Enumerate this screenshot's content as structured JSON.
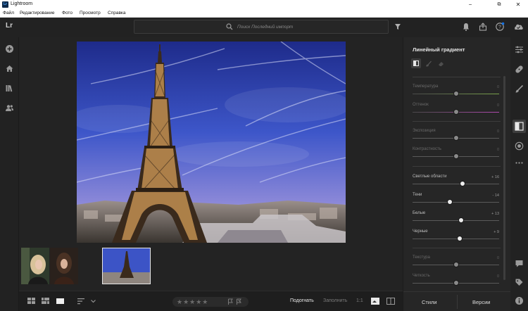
{
  "window": {
    "app_badge": "Lr",
    "title": "Lightroom",
    "minimize": "−",
    "maximize": "⧉",
    "close": "✕"
  },
  "menu": [
    "Файл",
    "Редактирование",
    "Фото",
    "Просмотр",
    "Справка"
  ],
  "topbar": {
    "logo": "Lr",
    "search_placeholder": "Поиск Последний импорт"
  },
  "panel": {
    "title": "Линейный градиент",
    "sliders": [
      {
        "label": "Температура",
        "value": "0",
        "level": 0.5,
        "dim": true
      },
      {
        "label": "Оттенок",
        "value": "0",
        "level": 0.5,
        "dim": true
      },
      {
        "label": "Экспозиция",
        "value": "0",
        "level": 0.5,
        "dim": true
      },
      {
        "label": "Контрастность",
        "value": "0",
        "level": 0.5,
        "dim": true
      },
      {
        "label": "Светлые области",
        "value": "+ 16",
        "level": 0.58,
        "dim": false
      },
      {
        "label": "Тени",
        "value": "- 14",
        "level": 0.43,
        "dim": false
      },
      {
        "label": "Белые",
        "value": "+ 13",
        "level": 0.565,
        "dim": false
      },
      {
        "label": "Черные",
        "value": "+ 9",
        "level": 0.545,
        "dim": false
      },
      {
        "label": "Текстура",
        "value": "0",
        "level": 0.5,
        "dim": true
      },
      {
        "label": "Четкость",
        "value": "0",
        "level": 0.5,
        "dim": true
      }
    ],
    "styles_button": "Стили",
    "versions_button": "Версии"
  },
  "bottombar": {
    "stars": "★★★★★",
    "fit": "Подогнать",
    "fill": "Заполнить",
    "one_to_one": "1:1"
  },
  "colors": {
    "accent": "#1473e6",
    "panel": "#262626",
    "sky": "#3a4fc4"
  }
}
